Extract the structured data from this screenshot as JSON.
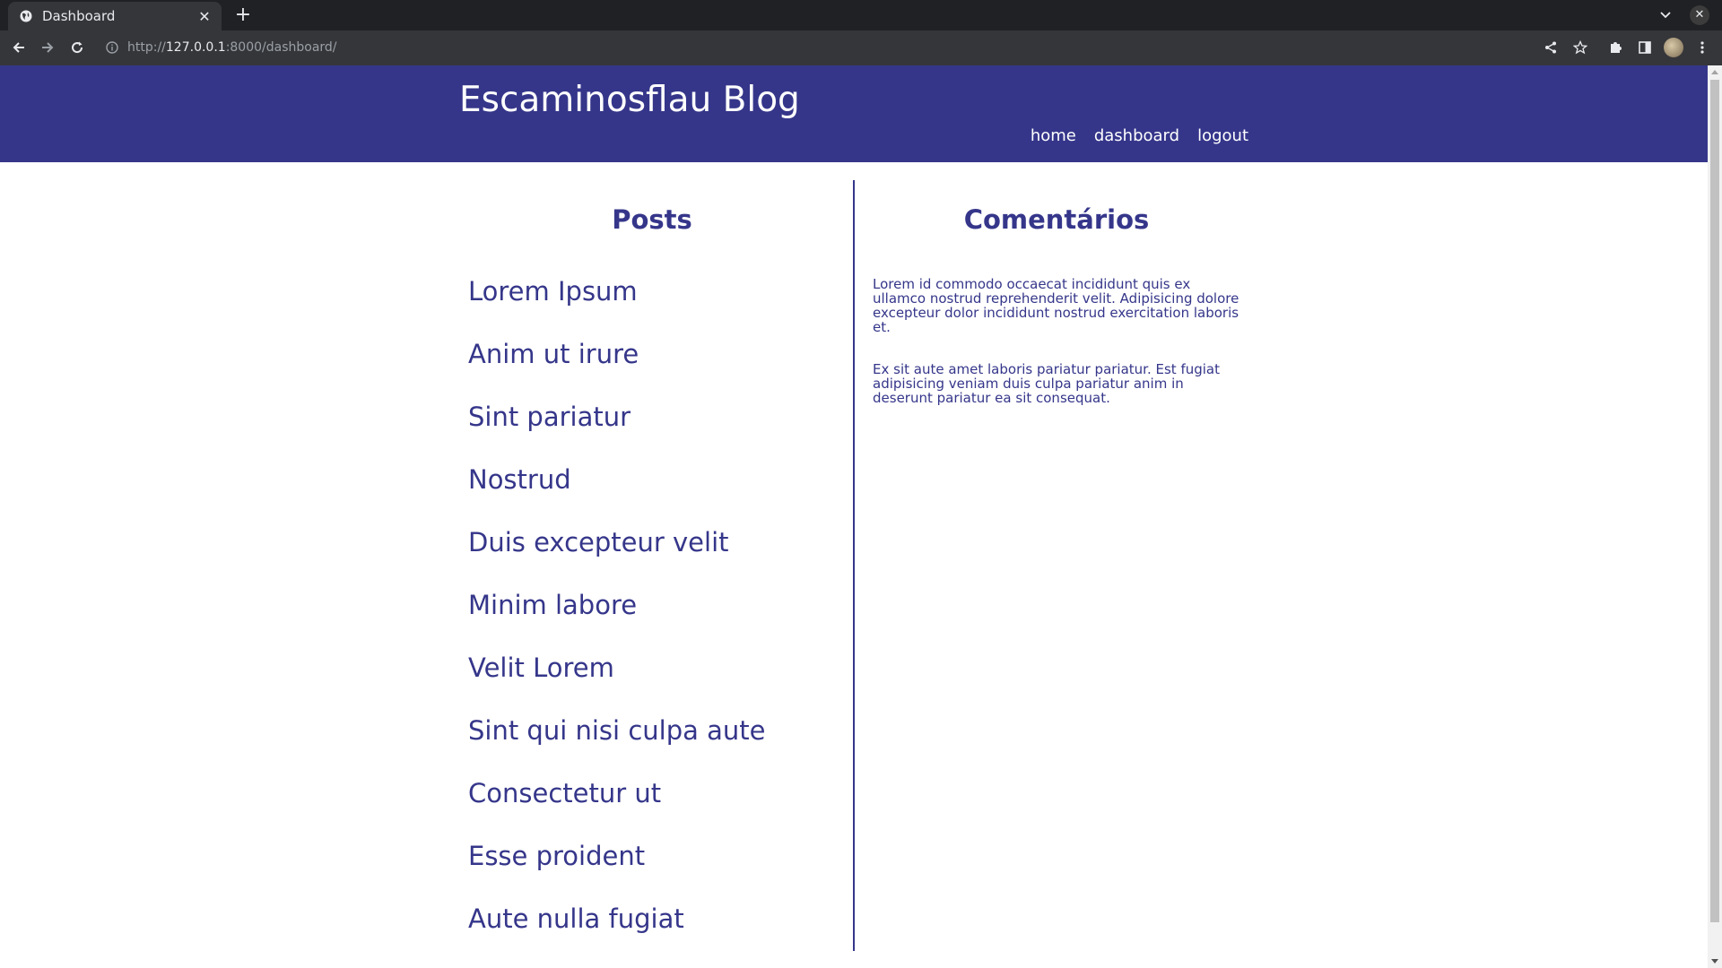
{
  "browser": {
    "tab_title": "Dashboard",
    "url_scheme": "http://",
    "url_host": "127.0.0.1",
    "url_rest": ":8000/dashboard/"
  },
  "header": {
    "site_title": "Escaminosflau Blog",
    "nav": [
      "home",
      "dashboard",
      "logout"
    ],
    "color": "#35368a"
  },
  "posts": {
    "title": "Posts",
    "items": [
      "Lorem Ipsum",
      "Anim ut irure",
      "Sint pariatur",
      "Nostrud",
      "Duis excepteur velit",
      "Minim labore",
      "Velit Lorem",
      "Sint qui nisi culpa aute",
      "Consectetur ut",
      "Esse proident",
      "Aute nulla fugiat"
    ]
  },
  "comments": {
    "title": "Comentários",
    "items": [
      "Lorem id commodo occaecat incididunt quis ex ullamco nostrud reprehenderit velit. Adipisicing dolore excepteur dolor incididunt nostrud exercitation laboris et.",
      "Ex sit aute amet laboris pariatur pariatur. Est fugiat adipisicing veniam duis culpa pariatur anim in deserunt pariatur ea sit consequat."
    ]
  }
}
